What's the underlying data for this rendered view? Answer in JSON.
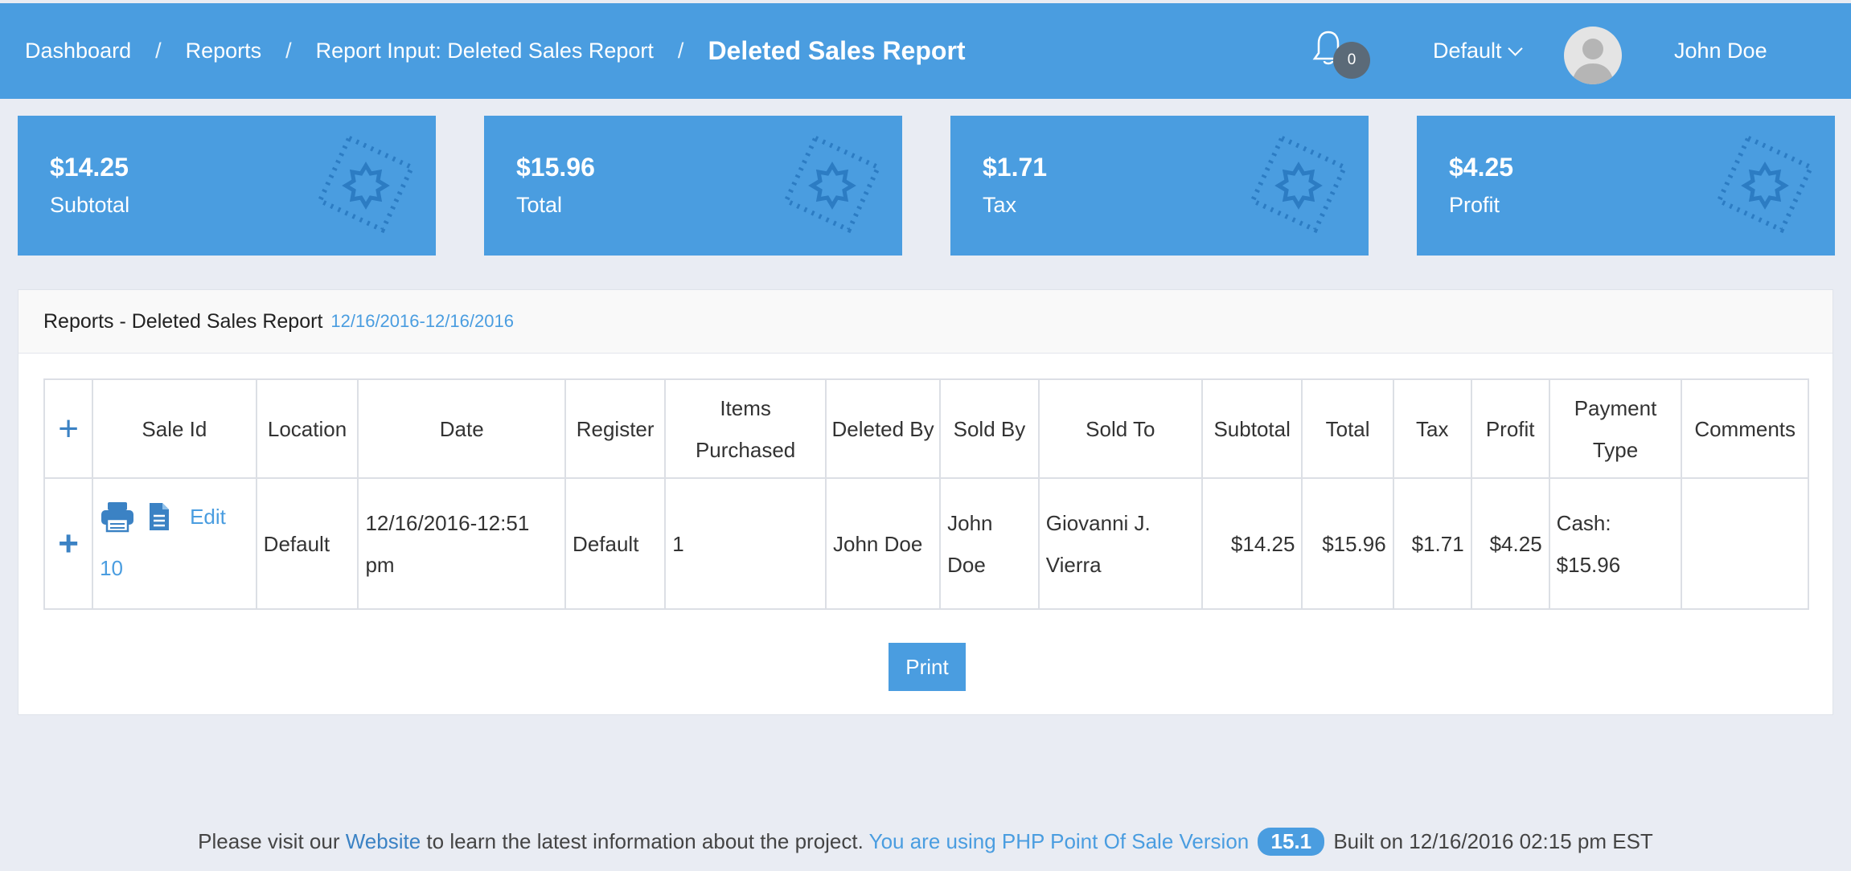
{
  "breadcrumb": {
    "items": [
      "Dashboard",
      "Reports",
      "Report Input: Deleted Sales Report"
    ],
    "separator": "/",
    "current": "Deleted Sales Report"
  },
  "header": {
    "notification_count": "0",
    "location": "Default",
    "user_name": "John Doe"
  },
  "cards": [
    {
      "value": "$14.25",
      "label": "Subtotal"
    },
    {
      "value": "$15.96",
      "label": "Total"
    },
    {
      "value": "$1.71",
      "label": "Tax"
    },
    {
      "value": "$4.25",
      "label": "Profit"
    }
  ],
  "panel": {
    "title": "Reports - Deleted Sales Report",
    "date_range": "12/16/2016-12/16/2016"
  },
  "table": {
    "expand_symbol": "+",
    "headers": [
      "Sale Id",
      "Location",
      "Date",
      "Register",
      "Items Purchased",
      "Deleted By",
      "Sold By",
      "Sold To",
      "Subtotal",
      "Total",
      "Tax",
      "Profit",
      "Payment Type",
      "Comments"
    ],
    "rows": [
      {
        "edit_label": "Edit",
        "sale_id": "10",
        "location": "Default",
        "date": "12/16/2016-12:51 pm",
        "register": "Default",
        "items_purchased": "1",
        "deleted_by": "John Doe",
        "sold_by": "John Doe",
        "sold_to": "Giovanni J. Vierra",
        "subtotal": "$14.25",
        "total": "$15.96",
        "tax": "$1.71",
        "profit": "$4.25",
        "payment_type": "Cash: $15.96",
        "comments": ""
      }
    ]
  },
  "print_label": "Print",
  "footer": {
    "text1": "Please visit our",
    "website": "Website",
    "text2": "to learn the latest information about the project.",
    "version_text": "You are using PHP Point Of Sale Version",
    "version": "15.1",
    "built": "Built on 12/16/2016 02:15 pm EST"
  },
  "colors": {
    "primary": "#4a9de0",
    "background": "#e9ecf3",
    "link": "#3b82c4"
  }
}
